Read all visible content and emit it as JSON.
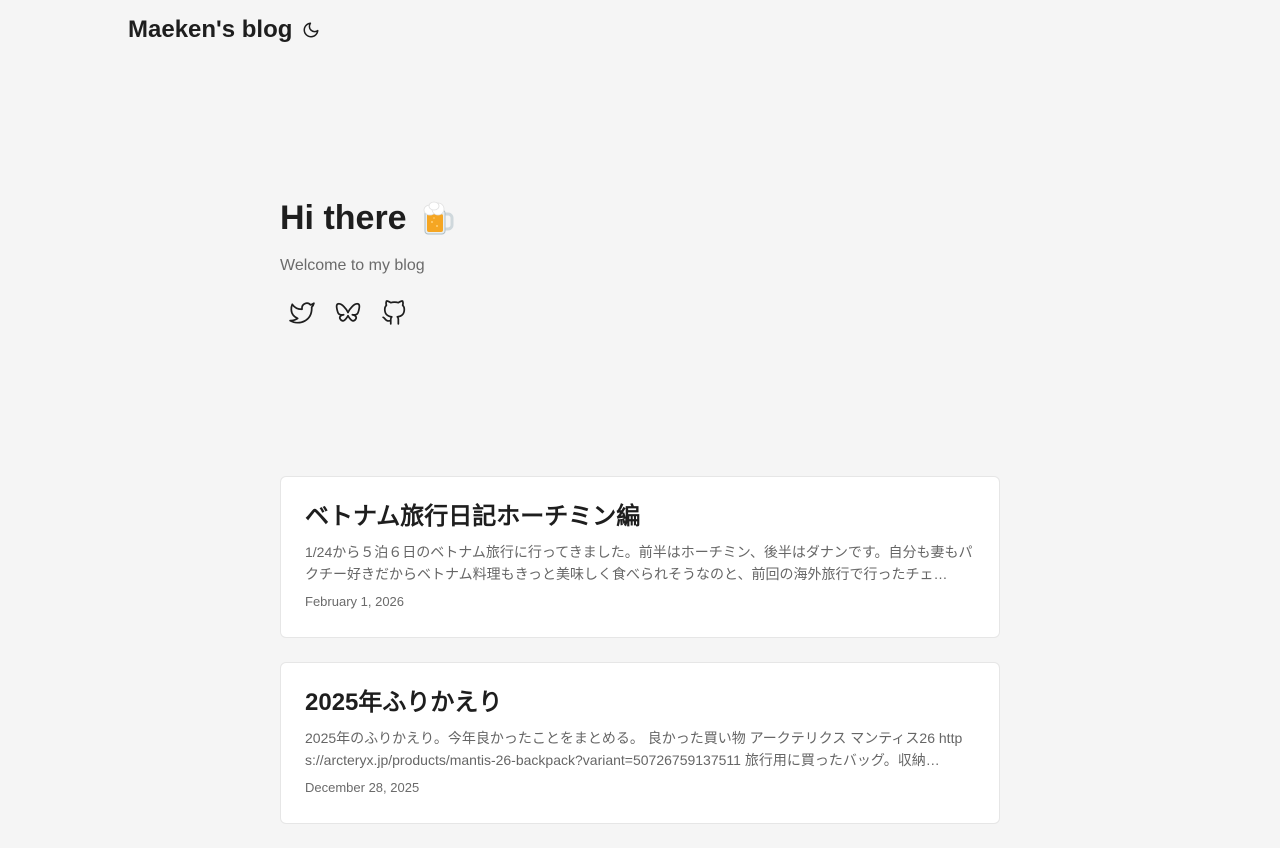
{
  "header": {
    "site_title": "Maeken's blog",
    "theme_toggle_icon": "moon-icon"
  },
  "hero": {
    "title": "Hi there",
    "emoji_icon": "beer-mug-icon",
    "subtitle": "Welcome to my blog",
    "social_links": [
      {
        "name": "twitter",
        "icon": "twitter-icon"
      },
      {
        "name": "bluesky",
        "icon": "butterfly-icon"
      },
      {
        "name": "github",
        "icon": "github-icon"
      }
    ]
  },
  "posts": [
    {
      "title": "ベトナム旅行日記ホーチミン編",
      "summary": "1/24から５泊６日のベトナム旅行に行ってきました。前半はホーチミン、後半はダナンです。自分も妻もパクチー好きだからベトナム料理もきっと美味しく食べられそうなのと、前回の海外旅行で行ったチェ…",
      "date": "February 1, 2026"
    },
    {
      "title": "2025年ふりかえり",
      "summary": "2025年のふりかえり。今年良かったことをまとめる。 良かった買い物 アークテリクス マンティス26 https://arcteryx.jp/products/mantis-26-backpack?variant=50726759137511 旅行用に買ったバッグ。収納…",
      "date": "December 28, 2025"
    }
  ],
  "colors": {
    "background": "#f5f5f5",
    "card": "#ffffff",
    "text": "#1e1e1e",
    "secondary_text": "#666666"
  }
}
